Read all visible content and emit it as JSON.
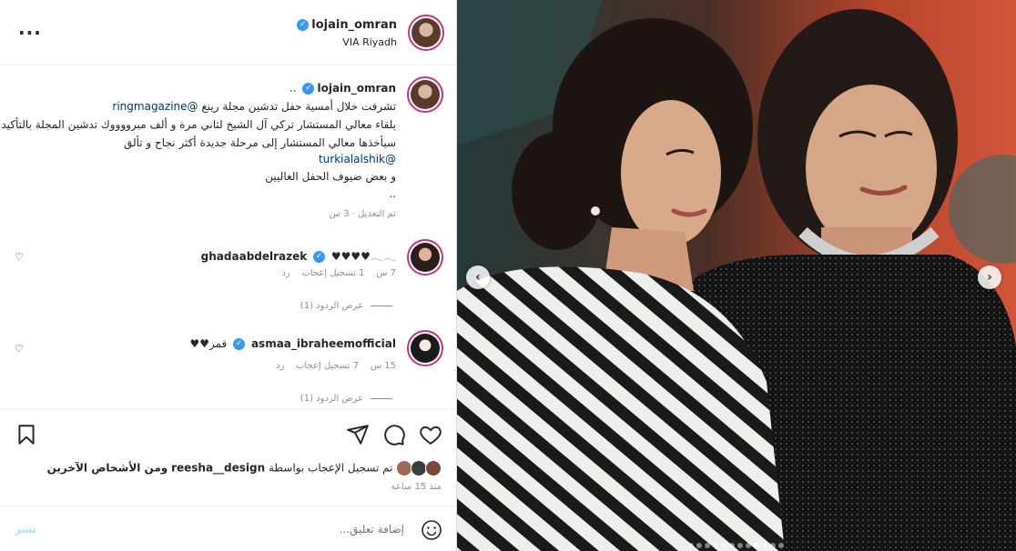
{
  "post": {
    "author": "lojain_omran",
    "location": "VIA Riyadh",
    "caption": {
      "line1": "..",
      "line2_prefix": "تشرفت خلال أمسية حفل تدشين مجلة رينغ",
      "line2_mention": "@ringmagazine",
      "line3": "بلقاء معالي المستشار تركي آل الشيخ لثاني مرة و ألف مبرووووك تدشين المجلة بالتأكيد",
      "line4": "سيأخذها معالي المستشار إلى مرحلة جديدة أكثر نجاح و تألق",
      "line5_mention": "@turkialalshik",
      "line6": "و بعض ضيوف الحفل الغاليين",
      "line7": ".."
    },
    "caption_meta": "تم التعديل · 3 س"
  },
  "comments": [
    {
      "user": "ghadaabdelrazek",
      "text": "♥♥♥♥𓂃𓂃",
      "time": "7 س",
      "likes": "1 تسجيل إعجاب",
      "reply": "رد",
      "view_replies": "عرض الردود (1)"
    },
    {
      "user": "asmaa_ibraheemofficial",
      "text": "قمر♥♥",
      "time": "15 س",
      "likes": "7 تسجيل إعجاب",
      "reply": "رد",
      "view_replies": "عرض الردود (1)"
    }
  ],
  "likes_summary": {
    "prefix": "تم تسجيل الإعجاب بواسطة",
    "user": "reesha__design",
    "suffix": "ومن الأشخاص الآخرين"
  },
  "posted_ago": "منذ 15 ساعة",
  "comment_input": {
    "placeholder": "إضافة تعليق...",
    "post_label": "نشر"
  },
  "carousel": {
    "total": 12,
    "active_index": 8
  },
  "icons": [
    "more-icon",
    "verified-icon",
    "heart-icon",
    "comment-icon",
    "share-icon",
    "bookmark-icon",
    "emoji-icon",
    "chevron-left-icon",
    "chevron-right-icon"
  ],
  "colors": {
    "link": "#00376b",
    "verified": "#3897f0",
    "muted": "#8e8e8e",
    "post_btn": "#b2dffc"
  }
}
